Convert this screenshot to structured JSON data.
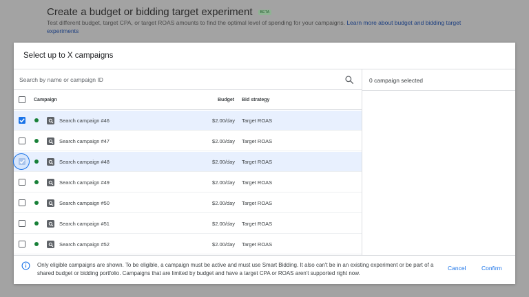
{
  "background": {
    "title": "Create a budget or bidding target experiment",
    "badge": "BETA",
    "description": "Test different budget, target CPA, or target ROAS amounts to find the optimal level of spending for your campaigns.",
    "link": "Learn more about budget and bidding target experiments"
  },
  "dialog": {
    "title": "Select up to X campaigns",
    "search": {
      "placeholder": "Search by name or campaign ID",
      "value": ""
    },
    "selected_count": "0 campaign selected",
    "table": {
      "headers": {
        "campaign": "Campaign",
        "budget": "Budget",
        "bid_strategy": "Bid strategy"
      },
      "rows": [
        {
          "name": "Search campaign #46",
          "budget": "$2.00/day",
          "bid_strategy": "Target ROAS",
          "checked": true,
          "status": "enabled"
        },
        {
          "name": "Search campaign #47",
          "budget": "$2.00/day",
          "bid_strategy": "Target ROAS",
          "checked": false,
          "status": "enabled"
        },
        {
          "name": "Search campaign #48",
          "budget": "$2.00/day",
          "bid_strategy": "Target ROAS",
          "checked": true,
          "status": "enabled"
        },
        {
          "name": "Search campaign #49",
          "budget": "$2.00/day",
          "bid_strategy": "Target ROAS",
          "checked": false,
          "status": "enabled"
        },
        {
          "name": "Search campaign #50",
          "budget": "$2.00/day",
          "bid_strategy": "Target ROAS",
          "checked": false,
          "status": "enabled"
        },
        {
          "name": "Search campaign #51",
          "budget": "$2.00/day",
          "bid_strategy": "Target ROAS",
          "checked": false,
          "status": "enabled"
        },
        {
          "name": "Search campaign #52",
          "budget": "$2.00/day",
          "bid_strategy": "Target ROAS",
          "checked": false,
          "status": "enabled"
        }
      ]
    },
    "footer": {
      "info": "Only eligible campaigns are shown. To be eligible, a campaign must be active and must use Smart Bidding. It also can't be in an existing experiment or be part of a shared budget or bidding portfolio. Campaigns that are limited by budget and have a target CPA or ROAS aren't supported right now.",
      "cancel_label": "Cancel",
      "confirm_label": "Confirm"
    }
  },
  "colors": {
    "accent": "#1a73e8",
    "status_enabled": "#188038",
    "selected_row": "#e8f0fe"
  },
  "icons": {
    "search": "search-icon",
    "info": "info-icon",
    "campaign_type": "search-campaign-icon",
    "status": "status-dot"
  }
}
